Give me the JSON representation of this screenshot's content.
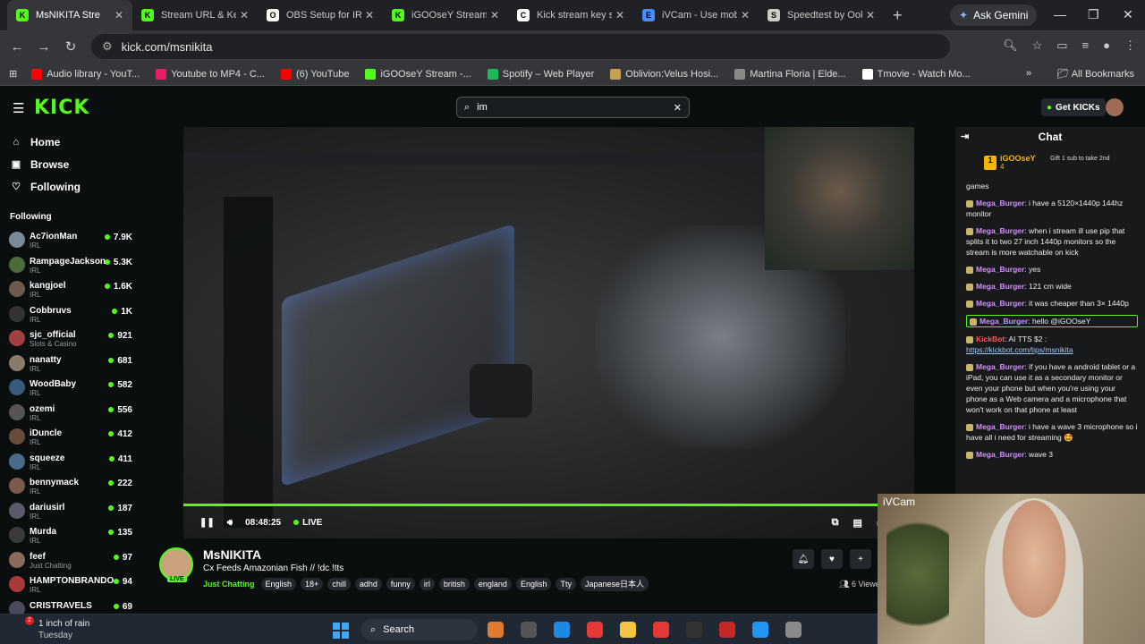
{
  "browser": {
    "tabs": [
      {
        "label": "MsNIKITA Stre",
        "color": "#53fc18",
        "glyph": "K"
      },
      {
        "label": "Stream URL & Key",
        "color": "#53fc18",
        "glyph": "K"
      },
      {
        "label": "OBS Setup for IRL",
        "color": "#ffffff",
        "glyph": "O"
      },
      {
        "label": "iGOOseY Stream",
        "color": "#53fc18",
        "glyph": "K"
      },
      {
        "label": "Kick stream key se",
        "color": "#ffffff",
        "glyph": "C"
      },
      {
        "label": "iVCam - Use mobi",
        "color": "#4a8cff",
        "glyph": "E"
      },
      {
        "label": "Speedtest by Ook",
        "color": "#cccccc",
        "glyph": "S"
      }
    ],
    "ask_gemini": "Ask Gemini",
    "url": "kick.com/msnikita",
    "bookmarks": [
      {
        "label": "Audio library - YouT...",
        "color": "#ff0000"
      },
      {
        "label": "Youtube to MP4 - C...",
        "color": "#e91e63"
      },
      {
        "label": "(6) YouTube",
        "color": "#ff0000"
      },
      {
        "label": "iGOOseY Stream -...",
        "color": "#53fc18"
      },
      {
        "label": "Spotify – Web Player",
        "color": "#1db954"
      },
      {
        "label": "Oblivion:Velus Hosi...",
        "color": "#c8a050"
      },
      {
        "label": "Martina Floria | Elde...",
        "color": "#888888"
      },
      {
        "label": "Tmovie - Watch Mo...",
        "color": "#ffffff"
      }
    ],
    "all_bookmarks": "All Bookmarks"
  },
  "kick": {
    "logo": "KICK",
    "search_value": "im",
    "get_kicks": "Get KICKs",
    "nav": [
      {
        "label": "Home",
        "icon": "home-icon",
        "glyph": "⌂"
      },
      {
        "label": "Browse",
        "icon": "browse-icon",
        "glyph": "▣"
      },
      {
        "label": "Following",
        "icon": "heart-icon",
        "glyph": "♡"
      }
    ],
    "following_header": "Following",
    "following": [
      {
        "name": "Ac7ionMan",
        "sub": "IRL",
        "viewers": "7.9K",
        "color": "#7a8a99"
      },
      {
        "name": "RampageJackson",
        "sub": "IRL",
        "viewers": "5.3K",
        "color": "#4c6a3a"
      },
      {
        "name": "kangjoel",
        "sub": "IRL",
        "viewers": "1.6K",
        "color": "#6e5a4c"
      },
      {
        "name": "Cobbruvs",
        "sub": "IRL",
        "viewers": "1K",
        "color": "#333333"
      },
      {
        "name": "sjc_official",
        "sub": "Slots & Casino",
        "viewers": "921",
        "color": "#a04040"
      },
      {
        "name": "nanatty",
        "sub": "IRL",
        "viewers": "681",
        "color": "#8a7a6a"
      },
      {
        "name": "WoodBaby",
        "sub": "IRL",
        "viewers": "582",
        "color": "#3a5a7a"
      },
      {
        "name": "ozemi",
        "sub": "IRL",
        "viewers": "556",
        "color": "#555555"
      },
      {
        "name": "iDuncle",
        "sub": "IRL",
        "viewers": "412",
        "color": "#6a4a3a"
      },
      {
        "name": "squeeze",
        "sub": "IRL",
        "viewers": "411",
        "color": "#4a6a8a"
      },
      {
        "name": "bennymack",
        "sub": "IRL",
        "viewers": "222",
        "color": "#7a5a4a"
      },
      {
        "name": "dariusirl",
        "sub": "IRL",
        "viewers": "187",
        "color": "#5a5a6a"
      },
      {
        "name": "Murda",
        "sub": "IRL",
        "viewers": "135",
        "color": "#3a3a3a"
      },
      {
        "name": "feef",
        "sub": "Just Chatting",
        "viewers": "97",
        "color": "#8a6a5a"
      },
      {
        "name": "HAMPTONBRANDO",
        "sub": "IRL",
        "viewers": "94",
        "color": "#aa3a3a"
      },
      {
        "name": "CRISTRAVELS",
        "sub": "",
        "viewers": "69",
        "color": "#4a4a5a"
      }
    ],
    "player": {
      "time": "08:48:25",
      "live": "LIVE"
    },
    "stream": {
      "channel": "MsNIKITA",
      "live_tag": "LIVE",
      "title": "Cx Feeds Amazonian Fish // !dc !tts",
      "category": "Just Chatting",
      "tags": [
        "English",
        "18+",
        "chill",
        "adhd",
        "funny",
        "irl",
        "british",
        "england",
        "English",
        "Tty",
        "Japanese日本人"
      ],
      "viewers": "6 Viewers"
    },
    "chat": {
      "title": "Chat",
      "pinned": {
        "name": "iGOOseY",
        "count": "4",
        "text": "Gift 1 sub to take 2nd"
      },
      "first_line": "games",
      "messages": [
        {
          "user": "Mega_Burger",
          "text": ": i have a 5120×1440p 144hz monitor",
          "bot": false,
          "highlight": false
        },
        {
          "user": "Mega_Burger",
          "text": ": when i stream ill use pip that splits it to two 27 inch 1440p monitors so the stream is more watchable on kick",
          "bot": false,
          "highlight": false
        },
        {
          "user": "Mega_Burger",
          "text": ": yes",
          "bot": false,
          "highlight": false
        },
        {
          "user": "Mega_Burger",
          "text": ": 121 cm wide",
          "bot": false,
          "highlight": false
        },
        {
          "user": "Mega_Burger",
          "text": ": it was cheaper than 3× 1440p",
          "bot": false,
          "highlight": false
        },
        {
          "user": "Mega_Burger",
          "text": ": hello @iGOOseY",
          "bot": false,
          "highlight": true
        },
        {
          "user": "KickBot",
          "text": ": AI TTS $2 :",
          "link": "https://kickbot.com/tips/msnikita",
          "bot": true,
          "highlight": false
        },
        {
          "user": "Mega_Burger",
          "text": ": if you have a android tablet or a iPad, you can use it as a secondary monitor or even your phone but when you're using your phone as a Web camera and a microphone that won't work on that phone at least",
          "bot": false,
          "highlight": false
        },
        {
          "user": "Mega_Burger",
          "text": ": i have a wave 3 microphone so i have all i need for streaming 🤩",
          "bot": false,
          "highlight": false
        },
        {
          "user": "Mega_Burger",
          "text": ": wave 3",
          "bot": false,
          "highlight": false
        }
      ]
    }
  },
  "facecam_label": "iVCam",
  "taskbar": {
    "weather_badge": "2",
    "weather_text": "1 inch of rain",
    "weather_sub": "Tuesday",
    "search": "Search",
    "apps": [
      "#e07a30",
      "#555555",
      "#1e88e5",
      "#e53935",
      "#f4c542",
      "#e53935",
      "#333333",
      "#c62828",
      "#2196f3",
      "#8a8a8a"
    ]
  }
}
